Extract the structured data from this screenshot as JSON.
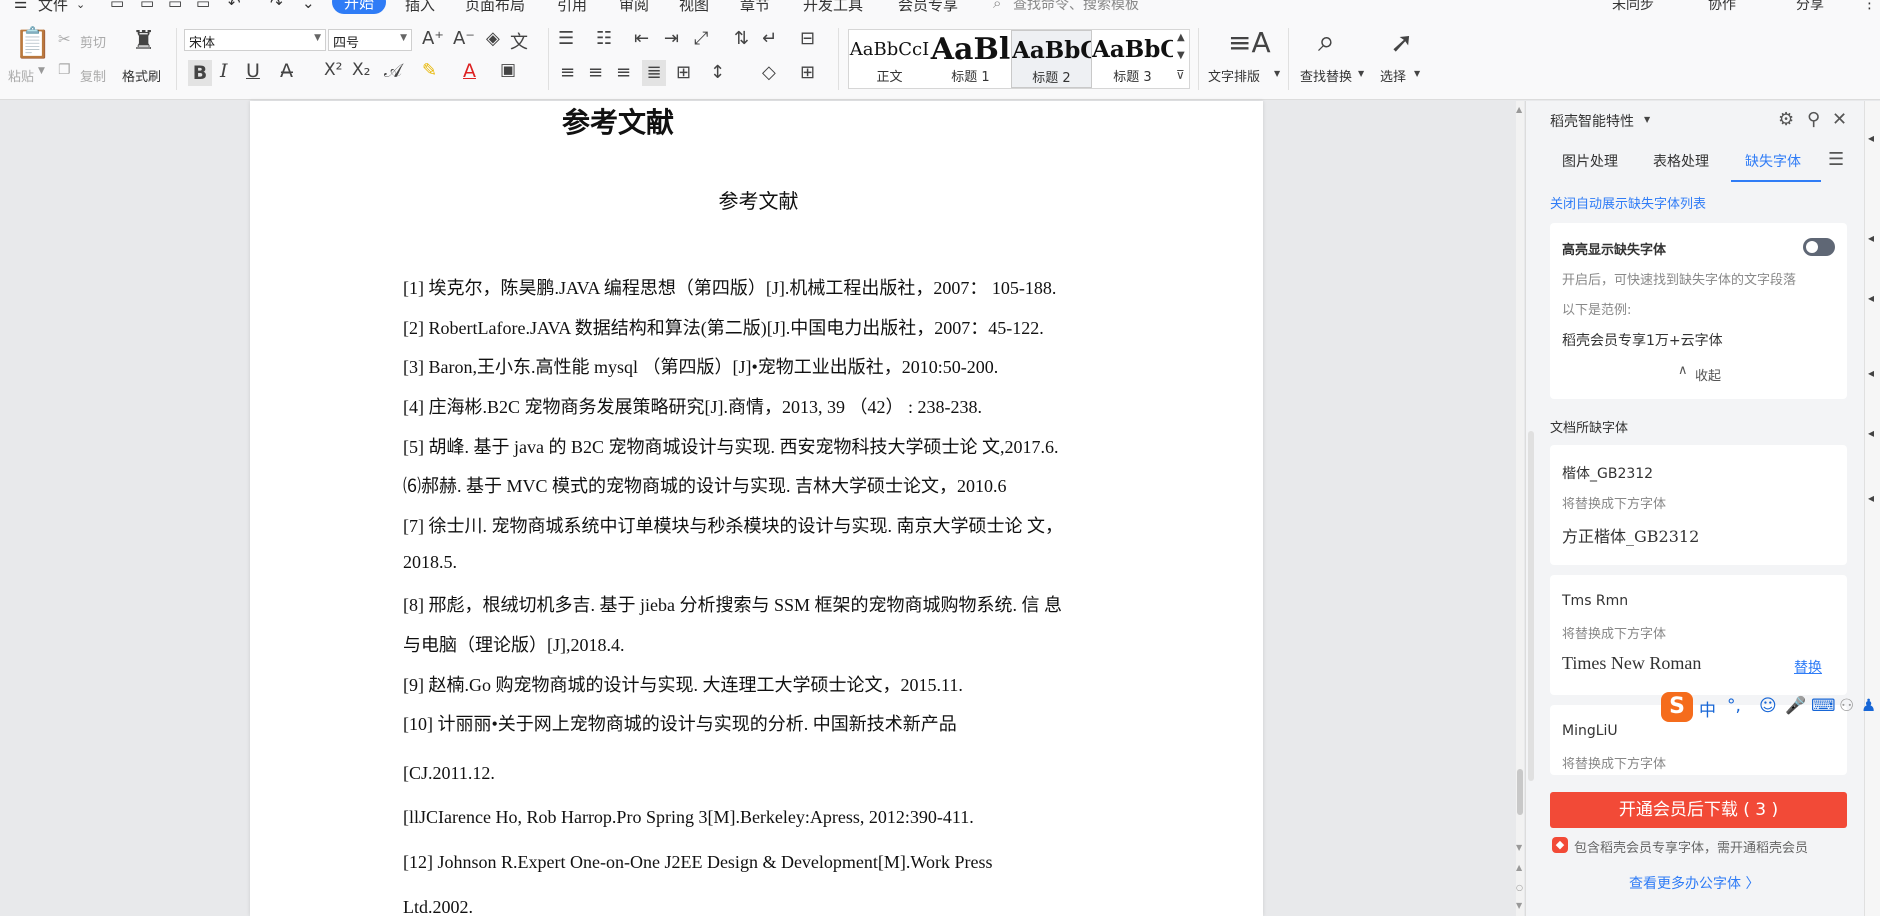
{
  "menu": {
    "file": "文件",
    "tabs": [
      "开始",
      "插入",
      "页面布局",
      "引用",
      "审阅",
      "视图",
      "章节",
      "开发工具",
      "会员专享"
    ],
    "active_tab": "开始",
    "search_placeholder": "查找命令、搜索模板",
    "right": [
      "未同步",
      "协作",
      "分享"
    ]
  },
  "ribbon": {
    "paste": "粘贴",
    "cut": "剪切",
    "copy": "复制",
    "format_painter": "格式刷",
    "font_name": "宋体",
    "font_size": "四号",
    "styles": [
      {
        "preview": "AaBbCcI",
        "label": "正文"
      },
      {
        "preview": "AaBl",
        "label": "标题 1"
      },
      {
        "preview": "AaBbC",
        "label": "标题 2"
      },
      {
        "preview": "AaBbC",
        "label": "标题 3"
      }
    ],
    "text_layout": "文字排版",
    "find_replace": "查找替换",
    "select": "选择"
  },
  "document": {
    "top_heading": "参考文献",
    "title": "参考文献",
    "refs": [
      "[1]   埃克尔，陈昊鹏.JAVA 编程思想（第四版）[J].机械工程出版社，2007：  105-188.",
      "[2]   RobertLafore.JAVA 数据结构和算法(第二版)[J].中国电力出版社，2007：45-122.",
      "[3]   Baron,王小东.高性能 mysql  （第四版）[J]•宠物工业出版社，2010:50-200.",
      "[4]   庄海彬.B2C 宠物商务发展策略研究[J].商情，2013, 39  （42）  : 238-238.",
      "[5]   胡峰. 基于 java 的 B2C 宠物商城设计与实现. 西安宠物科技大学硕士论  文,2017.6.",
      "⑹郝赫. 基于 MVC 模式的宠物商城的设计与实现. 吉林大学硕士论文，2010.6",
      "[7]   徐士川. 宠物商城系统中订单模块与秒杀模块的设计与实现. 南京大学硕士论  文，",
      "2018.5.",
      "[8]   邢彪，根绒切机多吉. 基于 jieba 分析搜索与 SSM 框架的宠物商城购物系统. 信  息",
      "与电脑（理论版）[J],2018.4.",
      "[9]   赵楠.Go 购宠物商城的设计与实现. 大连理工大学硕士论文，2015.11.",
      "[10]   计丽丽•关于网上宠物商城的设计与实现的分析. 中国新技术新产品",
      "[CJ.2011.12.",
      "[llJCIarence Ho, Rob Harrop.Pro Spring 3[M].Berkeley:Apress, 2012:390-411.",
      "[12]   Johnson R.Expert One-on-One J2EE Design & Development[M].Work Press",
      "Ltd.2002."
    ]
  },
  "panel": {
    "title": "稻壳智能特性",
    "tabs": [
      "图片处理",
      "表格处理",
      "缺失字体"
    ],
    "active_tab": "缺失字体",
    "close_auto_link": "关闭自动展示缺失字体列表",
    "highlight": {
      "title": "高亮显示缺失字体",
      "desc": "开启后，可快速找到缺失字体的文字段落",
      "example_label": "以下是范例:",
      "example_text": "稻壳会员专享1万+云字体",
      "collapse": "收起"
    },
    "missing_title": "文档所缺字体",
    "fonts": [
      {
        "name": "楷体_GB2312",
        "hint": "将替换成下方字体",
        "replacement": "方正楷体_GB2312",
        "action": ""
      },
      {
        "name": "Tms Rmn",
        "hint": "将替换成下方字体",
        "replacement": "Times New Roman",
        "action": "替换"
      },
      {
        "name": "MingLiU",
        "hint": "将替换成下方字体",
        "replacement": "",
        "action": ""
      }
    ],
    "download_button": "开通会员后下载 ( 3 )",
    "member_note": "包含稻壳会员专享字体，需开通稻壳会员",
    "more_link": "查看更多办公字体 〉"
  },
  "ime": {
    "items": [
      "中",
      "°,",
      "☺",
      "🎤",
      "⌨"
    ]
  },
  "colors": {
    "accent": "#2f7cf6",
    "download_red": "#f24a37",
    "ime_orange": "#f56c1c"
  }
}
